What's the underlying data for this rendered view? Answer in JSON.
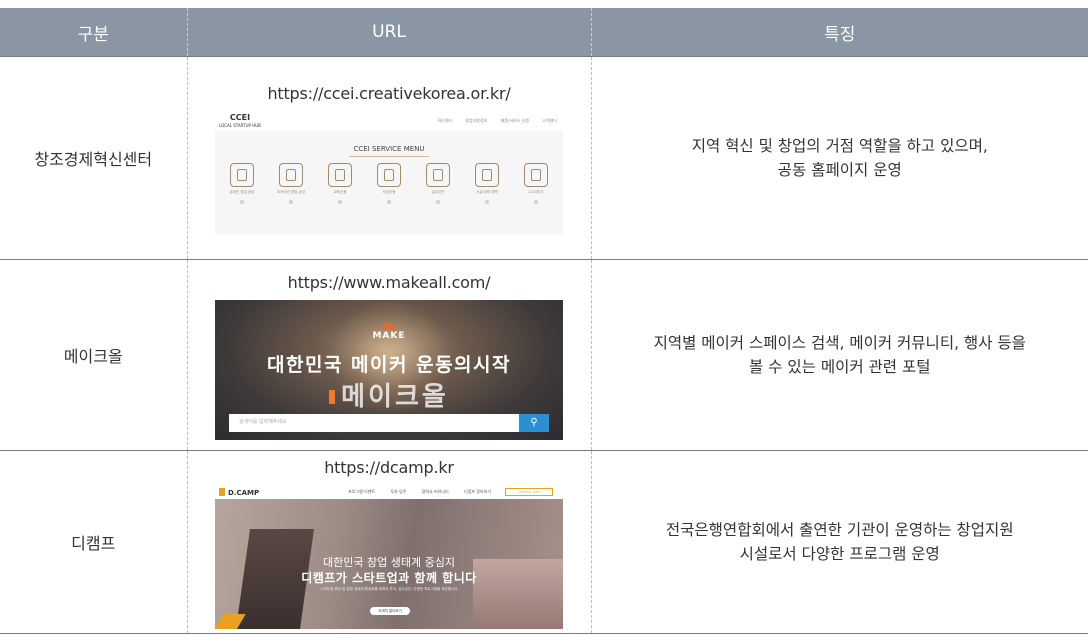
{
  "header": {
    "col_category": "구분",
    "col_url": "URL",
    "col_feature": "특징"
  },
  "rows": [
    {
      "category": "창조경제혁신센터",
      "url": "https://ccei.creativekorea.or.kr/",
      "feature_lines": [
        "지역 혁신 및 창업의 거점 역할을 하고 있으며,",
        "공동 홈페이지 운영"
      ],
      "screenshot": {
        "logo": "CCEI",
        "logo_sub": "LOCAL STARTUP HUB",
        "nav": [
          "혁신센터",
          "창업지원정보",
          "제품/서비스 신청",
          "고객센터"
        ],
        "menu_title": "CCEI SERVICE MENU",
        "menu_items": [
          {
            "label": "온라인 창업 상담",
            "icon": "counsel-icon"
          },
          {
            "label": "오프라인 창업 상담",
            "icon": "meeting-icon"
          },
          {
            "label": "교육신청",
            "icon": "education-icon"
          },
          {
            "label": "사업신청",
            "icon": "business-icon"
          },
          {
            "label": "입주공간",
            "icon": "calendar-icon"
          },
          {
            "label": "시설 장비 예약",
            "icon": "equipment-icon"
          },
          {
            "label": "CCEI투자",
            "icon": "investment-icon"
          }
        ]
      }
    },
    {
      "category": "메이크올",
      "url": "https://www.makeall.com/",
      "feature_lines": [
        "지역별 메이커 스페이스 검색, 메이커 커뮤니티, 행사 등을",
        "볼 수 있는 메이커 관련 포털"
      ],
      "screenshot": {
        "logo": "MAKE",
        "headline": "대한민국 메이커 운동의시작",
        "brand": "메이크올",
        "search_placeholder": "검색어를 입력해주세요",
        "search_icon": "search-icon"
      }
    },
    {
      "category": "디캠프",
      "url": "https://dcamp.kr",
      "feature_lines": [
        "전국은행연합회에서 출연한 기관이 운영하는 창업지원",
        "시설로서 다양한 프로그램 운영"
      ],
      "screenshot": {
        "logo": "D.CAMP",
        "nav": [
          "프로그램·이벤트",
          "투자·입주",
          "협력사·커뮤니티",
          "디캠프 알아보기"
        ],
        "nav_button": "OFFICIAL SITE",
        "headline1": "대한민국 창업 생태계 중심지",
        "headline2": "디캠프가 스타트업과 함께 합니다",
        "body_text": "스타트업 육성 및 창업 생태계 활성화를 위하여 투자, 입주공간, 다양한 프로그램을 제공합니다",
        "more_button": "자세히 알아보기"
      }
    }
  ],
  "colors": {
    "header_bg": "#8a96a4",
    "header_text": "#ffffff",
    "rule": "#7a7a7a"
  }
}
